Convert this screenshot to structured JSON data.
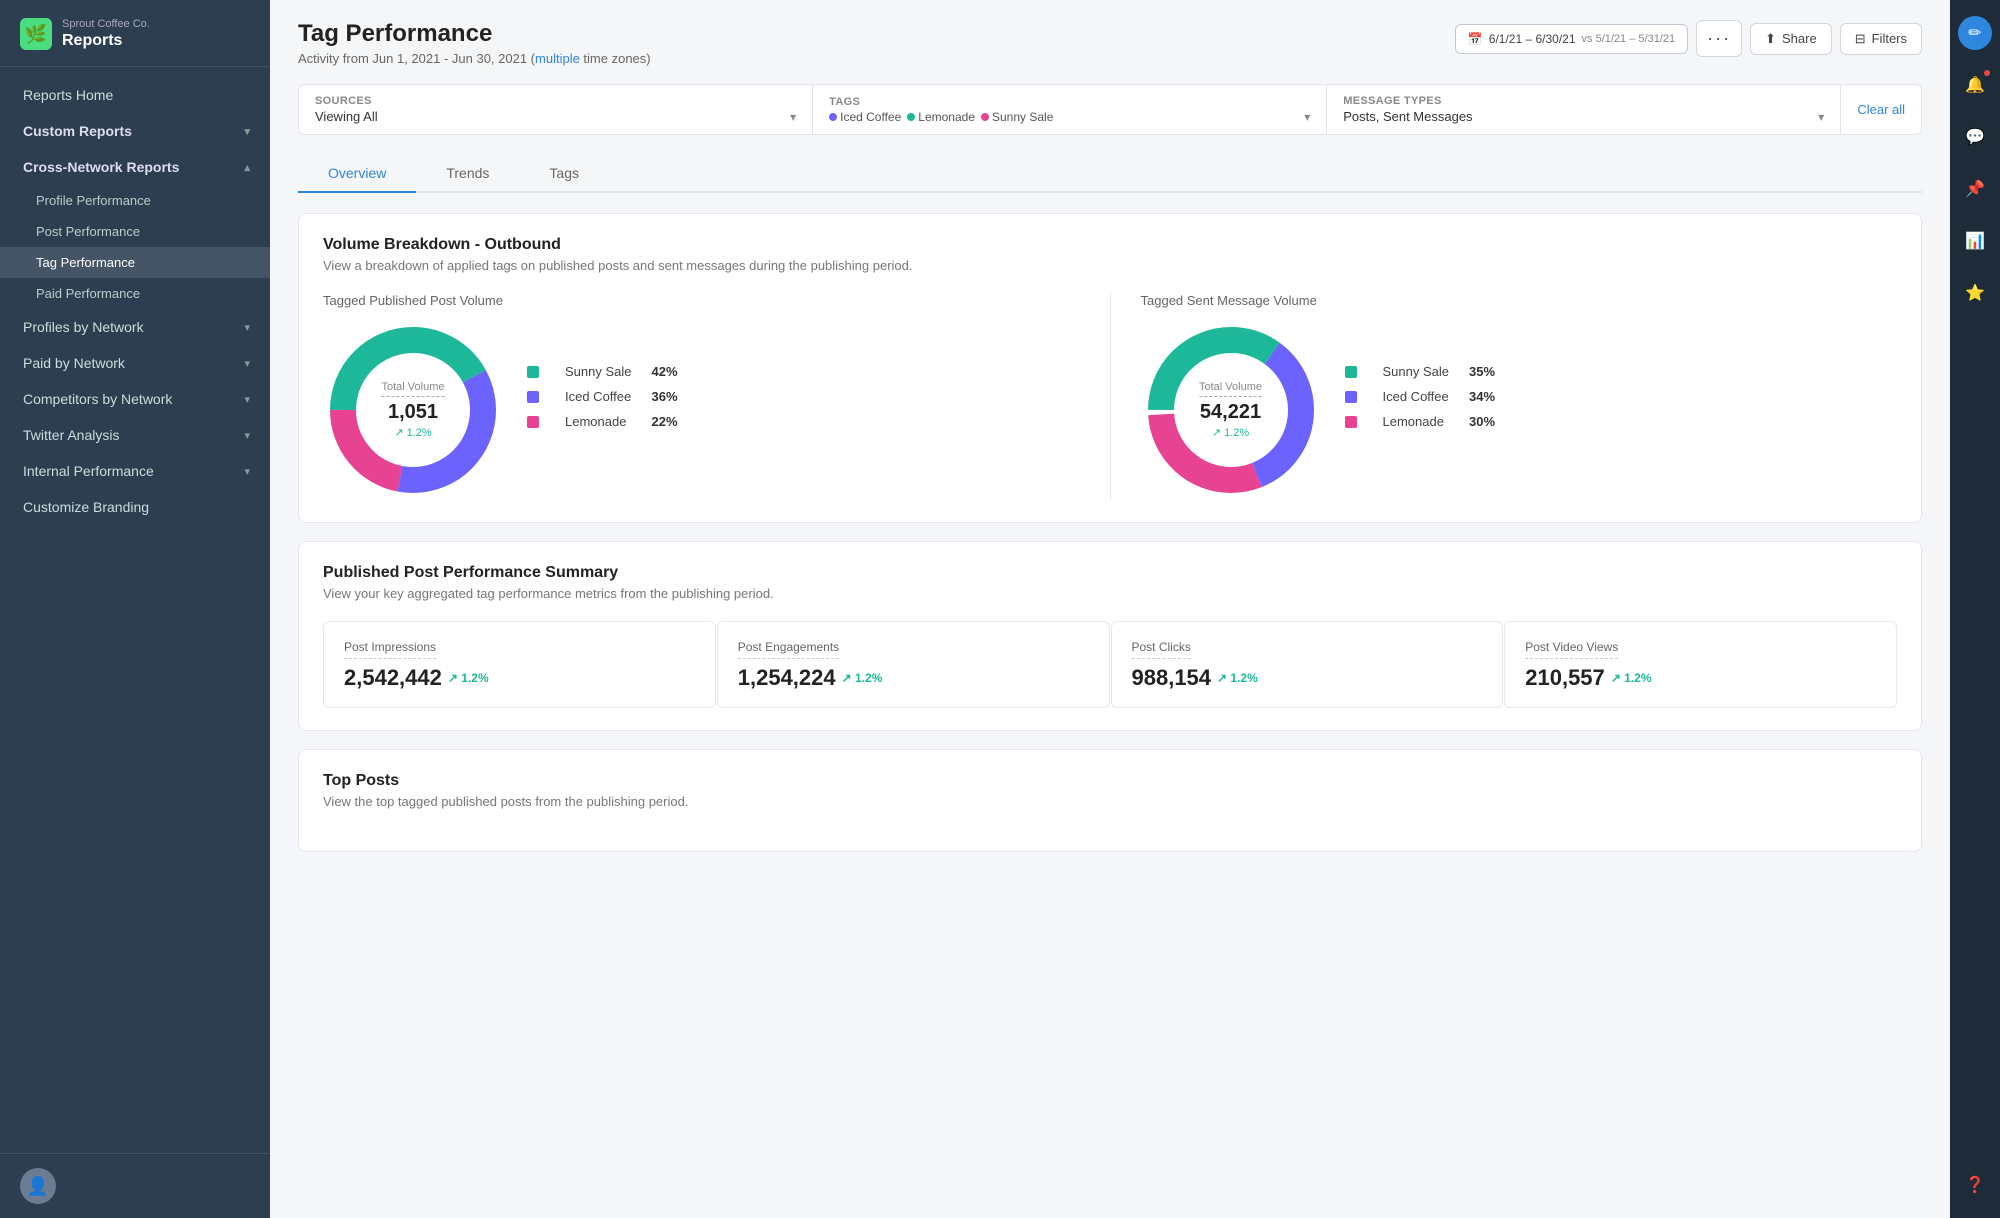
{
  "sidebar": {
    "company": "Sprout Coffee Co.",
    "section": "Reports",
    "nav": [
      {
        "id": "reports-home",
        "label": "Reports Home",
        "level": 0
      },
      {
        "id": "custom-reports",
        "label": "Custom Reports",
        "level": 0,
        "chevron": "▾"
      },
      {
        "id": "cross-network",
        "label": "Cross-Network Reports",
        "level": 0,
        "chevron": "▴",
        "expanded": true
      },
      {
        "id": "profile-performance",
        "label": "Profile Performance",
        "level": 1
      },
      {
        "id": "post-performance",
        "label": "Post Performance",
        "level": 1
      },
      {
        "id": "tag-performance",
        "label": "Tag Performance",
        "level": 1,
        "active": true
      },
      {
        "id": "paid-performance",
        "label": "Paid Performance",
        "level": 1
      },
      {
        "id": "profiles-by-network",
        "label": "Profiles by Network",
        "level": 0,
        "chevron": "▾"
      },
      {
        "id": "paid-by-network",
        "label": "Paid by Network",
        "level": 0,
        "chevron": "▾"
      },
      {
        "id": "competitors-by-network",
        "label": "Competitors by Network",
        "level": 0,
        "chevron": "▾"
      },
      {
        "id": "twitter-analysis",
        "label": "Twitter Analysis",
        "level": 0,
        "chevron": "▾"
      },
      {
        "id": "internal-performance",
        "label": "Internal Performance",
        "level": 0,
        "chevron": "▾"
      },
      {
        "id": "customize-branding",
        "label": "Customize Branding",
        "level": 0
      }
    ]
  },
  "header": {
    "title": "Tag Performance",
    "subtitle": "Activity from Jun 1, 2021 - Jun 30, 2021",
    "subtitle_link": "multiple",
    "subtitle_suffix": " time zones)",
    "date_range": "6/1/21 – 6/30/21",
    "vs_range": "vs 5/1/21 – 5/31/21",
    "share_label": "Share",
    "filters_label": "Filters"
  },
  "filters": {
    "sources_label": "Sources",
    "sources_value": "Viewing All",
    "tags_label": "Tags",
    "tags": [
      {
        "name": "Iced Coffee",
        "color": "#6c63ff"
      },
      {
        "name": "Lemonade",
        "color": "#1db89a"
      },
      {
        "name": "Sunny Sale",
        "color": "#e84393"
      }
    ],
    "message_types_label": "Message Types",
    "message_types_value": "Posts, Sent Messages",
    "clear_all": "Clear all"
  },
  "tabs": [
    {
      "id": "overview",
      "label": "Overview",
      "active": true
    },
    {
      "id": "trends",
      "label": "Trends"
    },
    {
      "id": "tags",
      "label": "Tags"
    }
  ],
  "volume_breakdown": {
    "title": "Volume Breakdown - Outbound",
    "subtitle": "View a breakdown of applied tags on published posts and sent messages during the publishing period.",
    "left_chart": {
      "label": "Tagged Published Post Volume",
      "center_label": "Total Volume",
      "center_value": "1,051",
      "trend": "↗ 1.2%",
      "segments": [
        {
          "name": "Sunny Sale",
          "pct": 42,
          "color": "#1db89a"
        },
        {
          "name": "Iced Coffee",
          "pct": 36,
          "color": "#6c63ff"
        },
        {
          "name": "Lemonade",
          "pct": 22,
          "color": "#e84393"
        }
      ]
    },
    "right_chart": {
      "label": "Tagged Sent Message Volume",
      "center_label": "Total Volume",
      "center_value": "54,221",
      "trend": "↗ 1.2%",
      "segments": [
        {
          "name": "Sunny Sale",
          "pct": 35,
          "color": "#1db89a"
        },
        {
          "name": "Iced Coffee",
          "pct": 34,
          "color": "#6c63ff"
        },
        {
          "name": "Lemonade",
          "pct": 30,
          "color": "#e84393"
        }
      ]
    }
  },
  "post_performance": {
    "title": "Published Post Performance Summary",
    "subtitle": "View your key aggregated tag performance metrics from the publishing period.",
    "metrics": [
      {
        "id": "impressions",
        "label": "Post Impressions",
        "value": "2,542,442",
        "trend": "↗ 1.2%"
      },
      {
        "id": "engagements",
        "label": "Post Engagements",
        "value": "1,254,224",
        "trend": "↗ 1.2%"
      },
      {
        "id": "clicks",
        "label": "Post Clicks",
        "value": "988,154",
        "trend": "↗ 1.2%"
      },
      {
        "id": "video_views",
        "label": "Post Video Views",
        "value": "210,557",
        "trend": "↗ 1.2%"
      }
    ]
  },
  "top_posts": {
    "title": "Top Posts",
    "subtitle": "View the top tagged published posts from the publishing period."
  },
  "colors": {
    "accent": "#2e86de",
    "green": "#1db89a",
    "sidebar_bg": "#2c3e50",
    "active_item": "rgba(255,255,255,0.12)"
  }
}
